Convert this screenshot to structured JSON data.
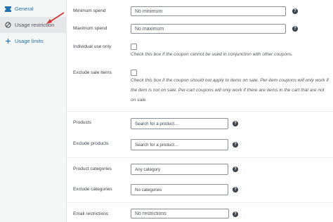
{
  "sidebar": {
    "items": [
      {
        "label": "General",
        "icon": "ticket-icon"
      },
      {
        "label": "Usage restriction",
        "icon": "block-icon"
      },
      {
        "label": "Usage limits",
        "icon": "plus-icon"
      }
    ]
  },
  "fields": {
    "minimum_spend": {
      "label": "Minimum spend",
      "placeholder": "No minimum"
    },
    "maximum_spend": {
      "label": "Maximum spend",
      "placeholder": "No maximum"
    },
    "individual_use": {
      "label": "Individual use only",
      "description": "Check this box if the coupon cannot be used in conjunction with other coupons."
    },
    "exclude_sale": {
      "label": "Exclude sale items",
      "description": "Check this box if the coupon should not apply to items on sale. Per-item coupons will only work if the item is not on sale. Per-cart coupons will only work if there are items in the cart that are not on sale."
    },
    "products": {
      "label": "Products",
      "placeholder": "Search for a product…"
    },
    "exclude_products": {
      "label": "Exclude products",
      "placeholder": "Search for a product…"
    },
    "product_categories": {
      "label": "Product categories",
      "placeholder": "Any category"
    },
    "exclude_categories": {
      "label": "Exclude categories",
      "placeholder": "No categories"
    },
    "email_restrictions": {
      "label": "Email restrictions",
      "placeholder": "No restrictions"
    }
  },
  "help_glyph": "?",
  "colors": {
    "accent": "#2271b1",
    "arrow": "#d63638",
    "active_tab": "#e5e7e8"
  }
}
